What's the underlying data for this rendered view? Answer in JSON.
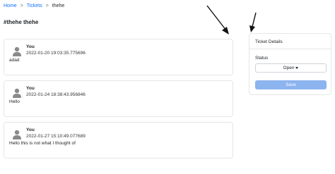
{
  "breadcrumb": {
    "home": "Home",
    "tickets": "Tickets",
    "current": "thehe",
    "separator": ">"
  },
  "page_title": "#thehe thehe",
  "messages": [
    {
      "author": "You",
      "timestamp": "2022-01-20 19:03:35.775696",
      "body": "adad"
    },
    {
      "author": "You",
      "timestamp": "2022-01-24 18:38:43.956846",
      "body": "Hello"
    },
    {
      "author": "You",
      "timestamp": "2022-01-27 15:10:49.077689",
      "body": "Hello this is not what I thought of"
    }
  ],
  "ticket_details": {
    "title": "Ticket Details",
    "status_label": "Status",
    "status_value": "Open",
    "save_label": "Save"
  },
  "colors": {
    "link": "#0d6efd",
    "save_button_bg": "#8cb4ef",
    "border": "#e4e6e9",
    "avatar": "#8a8a8a"
  },
  "icons": {
    "avatar": "user-silhouette-icon",
    "breadcrumb_separator": "chevron-right-icon",
    "dropdown": "caret-down-icon",
    "annotation": "arrow-icon"
  }
}
